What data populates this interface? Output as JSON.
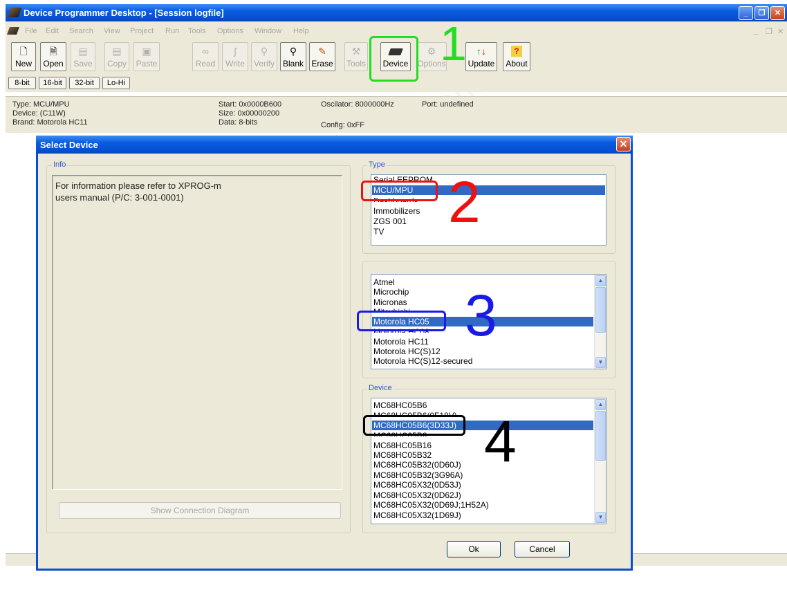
{
  "window": {
    "title": "Device Programmer Desktop - [Session logfile]"
  },
  "menu": [
    "File",
    "Edit",
    "Search",
    "View",
    "Project",
    "Run",
    "Tools",
    "Options",
    "Window",
    "Help"
  ],
  "toolbar": {
    "new": "New",
    "open": "Open",
    "save": "Save",
    "copy": "Copy",
    "paste": "Paste",
    "read": "Read",
    "write": "Write",
    "verify": "Verify",
    "blank": "Blank",
    "erase": "Erase",
    "tools": "Tools",
    "device": "Device",
    "options": "Options",
    "update": "Update",
    "about": "About"
  },
  "bitmodes": [
    "8-bit",
    "16-bit",
    "32-bit",
    "Lo-Hi"
  ],
  "status": {
    "type": "Type: MCU/MPU",
    "device": "Device: (C11W)",
    "brand": "Brand: Motorola HC11",
    "start": "Start: 0x0000B600",
    "size": "Size: 0x00000200",
    "data": "Data: 8-bits",
    "oscilator": "Oscilator: 8000000Hz",
    "port": "Port: undefined",
    "config": "Config: 0xFF"
  },
  "dialog": {
    "title": "Select Device",
    "info_label": "Info",
    "info_text_1": "For information please refer to XPROG-m",
    "info_text_2": "users manual (P/C: 3-001-0001)",
    "show_diagram": "Show Connection Diagram",
    "type_label": "Type",
    "type_items": [
      "Serial EEPROM",
      "MCU/MPU",
      "Dashboards",
      "Immobilizers",
      "ZGS 001",
      "TV"
    ],
    "type_selected": "MCU/MPU",
    "brand_items": [
      "Atmel",
      "Microchip",
      "Micronas",
      "Mitsubishi...",
      "Motorola HC05",
      "Motorola HC08",
      "Motorola HC11",
      "Motorola HC(S)12",
      "Motorola HC(S)12-secured"
    ],
    "brand_selected": "Motorola HC05",
    "device_label": "Device",
    "device_items": [
      "MC68HC05B6",
      "MC68HC05B6(0F18V)",
      "MC68HC05B6(3D33J)",
      "MC68HC05B8",
      "MC68HC05B16",
      "MC68HC05B32",
      "MC68HC05B32(0D60J)",
      "MC68HC05B32(3G96A)",
      "MC68HC05X32(0D53J)",
      "MC68HC05X32(0D62J)",
      "MC68HC05X32(0D69J;1H52A)",
      "MC68HC05X32(1D69J)"
    ],
    "device_selected": "MC68HC05B6(3D33J)",
    "ok": "Ok",
    "cancel": "Cancel"
  },
  "annotations": {
    "n1": "1",
    "n2": "2",
    "n3": "3",
    "n4": "4"
  },
  "watermark": "www.carlabimmo.com",
  "colors": {
    "selection": "#316ac5",
    "title_blue": "#0a5ce0",
    "green": "#22dd22",
    "red": "#ee1111",
    "blue": "#1a1ae6",
    "black": "#000000"
  }
}
